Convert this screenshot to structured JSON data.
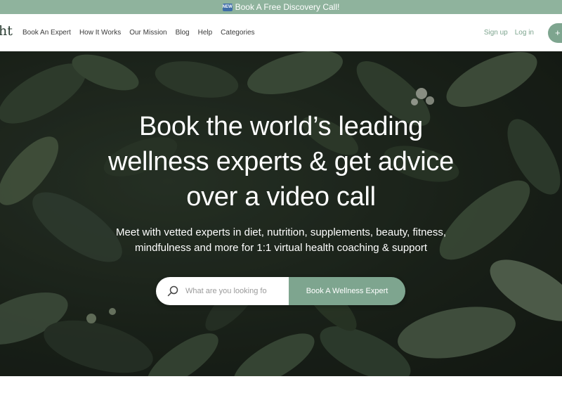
{
  "banner": {
    "badge": "NEW",
    "text": "Book A Free Discovery Call!"
  },
  "nav": {
    "logo": "ht",
    "links": [
      "Book An Expert",
      "How It Works",
      "Our Mission",
      "Blog",
      "Help",
      "Categories"
    ],
    "signup": "Sign up",
    "login": "Log in",
    "cta_partial": "+"
  },
  "hero": {
    "title_lines": [
      "Book the world’s leading",
      "wellness experts & get advice",
      "over a video call"
    ],
    "subtitle_lines": [
      "Meet with vetted experts in diet, nutrition, supplements, beauty, fitness,",
      "mindfulness and more for 1:1 virtual health coaching & support"
    ],
    "search_placeholder": "What are you looking fo",
    "search_button": "Book A Wellness Expert"
  },
  "colors": {
    "accent": "#7ea58f",
    "banner": "#8fb39d",
    "hero_dark": "#1c241b"
  }
}
